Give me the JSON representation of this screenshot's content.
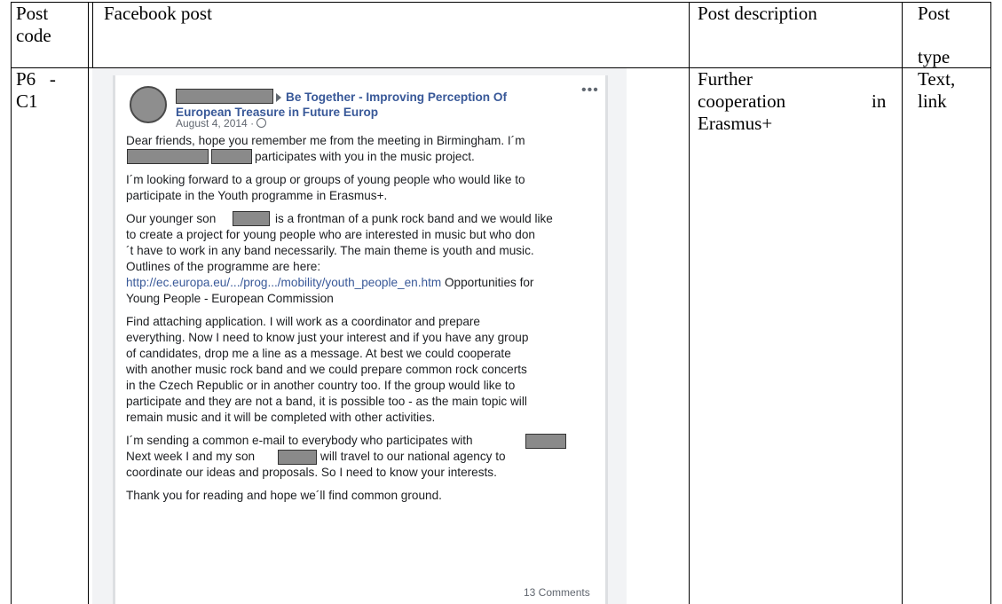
{
  "table": {
    "headers": {
      "post_code_line1": "Post",
      "post_code_line2": "code",
      "facebook_post": "Facebook post",
      "post_description": "Post description",
      "post_type_line1": "Post",
      "post_type_line2": "type"
    },
    "row": {
      "code_line1": "P6   -",
      "code_line2": "C1",
      "description_line1": "Further",
      "description_line2_a": "cooperation",
      "description_line2_b": "in",
      "description_line3": "Erasmus+",
      "type_line1": "Text,",
      "type_line2": "link"
    }
  },
  "post": {
    "group_line1": "Be Together - Improving Perception Of",
    "group_line2": "European Treasure in Future Europ",
    "date": "August 4, 2014 ·",
    "more_icon": "more-icon",
    "privacy_icon": "globe-icon",
    "p1_line1": "Dear friends, hope you remember me from the meeting in Birmingham. I´m",
    "p1_line2": "participates with you in the music project.",
    "p2_line1": "I´m looking forward to a group or groups of young people who would like to",
    "p2_line2": "participate in the Youth programme in Erasmus+.",
    "p3_line1a": "Our younger son",
    "p3_line1b": "is a frontman of a punk rock band and we would like",
    "p3_line2": "to create a project for young people who are interested in music but who don",
    "p3_line3": "´t have to work in any band necessarily. The main theme is youth and music.",
    "p3_line4": "Outlines of the programme are here:",
    "p3_link": "http://ec.europa.eu/.../prog.../mobility/youth_people_en.htm",
    "p3_link_after": "Opportunities for",
    "p3_line6": "Young People - European Commission",
    "p4_line1": "Find attaching application. I will work as a coordinator and prepare",
    "p4_line2": "everything. Now I need to know just your interest and if you have any group",
    "p4_line3": "of candidates, drop me a line as a message. At best we could cooperate",
    "p4_line4": "with another music rock band and we could prepare common rock concerts",
    "p4_line5": "in the Czech Republic or in another country too. If the group would like to",
    "p4_line6": "participate and they are not a band, it is possible too - as the main topic will",
    "p4_line7": "remain music and it will be completed with other activities.",
    "p5_line1": "I´m sending a common e-mail to everybody who participates with",
    "p5_line2a": "Next week I and my son",
    "p5_line2b": "will travel to our national agency to",
    "p5_line3": "coordinate our ideas and proposals. So I need to know your interests.",
    "p6_line1": "Thank you for reading and hope we´ll find common ground.",
    "comments": "13 Comments"
  },
  "colors": {
    "link": "#385898",
    "redaction": "#8a8a8a",
    "text": "#1c1e21",
    "meta": "#616770"
  }
}
